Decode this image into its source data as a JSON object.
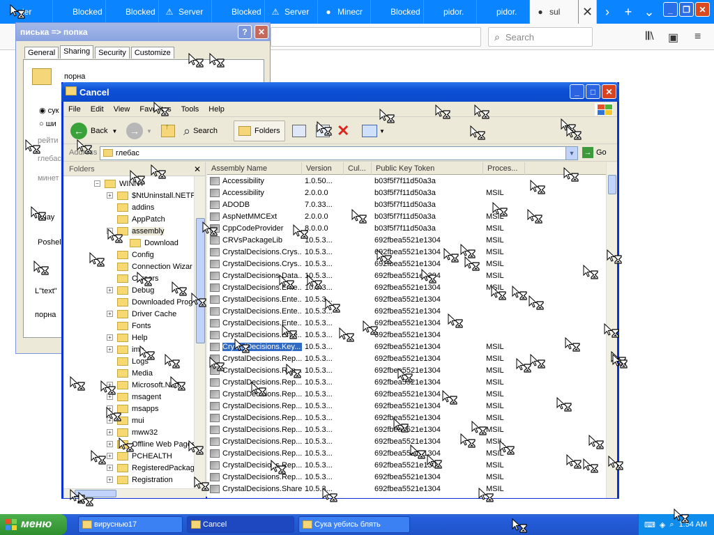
{
  "browser": {
    "tabs": [
      {
        "label": "der",
        "icon": "",
        "active": false
      },
      {
        "label": "Blocked",
        "icon": "",
        "active": false
      },
      {
        "label": "Blocked",
        "icon": "",
        "active": false
      },
      {
        "label": "Server",
        "icon": "⚠",
        "active": false
      },
      {
        "label": "Blocked",
        "icon": "",
        "active": false
      },
      {
        "label": "Server",
        "icon": "⚠",
        "active": false
      },
      {
        "label": "Minecr",
        "icon": "●",
        "active": false
      },
      {
        "label": "Blocked",
        "icon": "",
        "active": false
      },
      {
        "label": "pidor.",
        "icon": "",
        "active": false
      },
      {
        "label": "pidor.",
        "icon": "",
        "active": false
      },
      {
        "label": "sul",
        "icon": "●",
        "active": true
      }
    ],
    "close_tab": "✕",
    "scroll_right": "›",
    "new_tab": "+",
    "tab_list": "⌄",
    "search_placeholder": "Search",
    "win_min": "_",
    "win_max": "❐",
    "win_close": "✕"
  },
  "props_dialog": {
    "title": "писька => попка",
    "help": "?",
    "close": "✕",
    "tabs": [
      "General",
      "Sharing",
      "Security",
      "Customize"
    ],
    "selected_tab": "Sharing",
    "folder_name": "порна",
    "opt1": "сук",
    "opt2": "ши",
    "gray1": "рейти",
    "gray2": "глебас",
    "gray3": "минет",
    "text1": "Вчау",
    "text2": "Poshel",
    "text3": "L\"text\"",
    "text4": "порна"
  },
  "explorer": {
    "title": "Cancel",
    "menu": [
      "File",
      "Edit",
      "View",
      "Favorites",
      "Tools",
      "Help"
    ],
    "back_label": "Back",
    "search_label": "Search",
    "folders_label": "Folders",
    "address_label": "Address",
    "address_value": "глебас",
    "go_label": "Go",
    "folders_pane_title": "Folders",
    "tree": [
      {
        "label": "WINNT",
        "indent": 0,
        "exp": "−"
      },
      {
        "label": "$NtUninstall.NETF",
        "indent": 1,
        "exp": "+"
      },
      {
        "label": "addins",
        "indent": 1,
        "exp": ""
      },
      {
        "label": "AppPatch",
        "indent": 1,
        "exp": ""
      },
      {
        "label": "assembly",
        "indent": 1,
        "exp": "−",
        "selected": true
      },
      {
        "label": "Download",
        "indent": 2,
        "exp": ""
      },
      {
        "label": "Config",
        "indent": 1,
        "exp": ""
      },
      {
        "label": "Connection Wizar",
        "indent": 1,
        "exp": ""
      },
      {
        "label": "Cursors",
        "indent": 1,
        "exp": ""
      },
      {
        "label": "Debug",
        "indent": 1,
        "exp": "+"
      },
      {
        "label": "Downloaded Prog",
        "indent": 1,
        "exp": ""
      },
      {
        "label": "Driver Cache",
        "indent": 1,
        "exp": "+"
      },
      {
        "label": "Fonts",
        "indent": 1,
        "exp": ""
      },
      {
        "label": "Help",
        "indent": 1,
        "exp": "+"
      },
      {
        "label": "ime",
        "indent": 1,
        "exp": "+"
      },
      {
        "label": "Logs",
        "indent": 1,
        "exp": ""
      },
      {
        "label": "Media",
        "indent": 1,
        "exp": ""
      },
      {
        "label": "Microsoft.NET",
        "indent": 1,
        "exp": "+"
      },
      {
        "label": "msagent",
        "indent": 1,
        "exp": "+"
      },
      {
        "label": "msapps",
        "indent": 1,
        "exp": "+"
      },
      {
        "label": "mui",
        "indent": 1,
        "exp": "+"
      },
      {
        "label": "mww32",
        "indent": 1,
        "exp": "+"
      },
      {
        "label": "Offline Web Pages",
        "indent": 1,
        "exp": "+"
      },
      {
        "label": "PCHEALTH",
        "indent": 1,
        "exp": "+"
      },
      {
        "label": "RegisteredPackag",
        "indent": 1,
        "exp": "+"
      },
      {
        "label": "Registration",
        "indent": 1,
        "exp": "+"
      }
    ],
    "columns": [
      "Assembly Name",
      "Version",
      "Cul...",
      "Public Key Token",
      "Proces..."
    ],
    "rows": [
      {
        "name": "Accessibility",
        "version": "1.0.50...",
        "culture": "",
        "token": "b03f5f7f11d50a3a",
        "proc": ""
      },
      {
        "name": "Accessibility",
        "version": "2.0.0.0",
        "culture": "",
        "token": "b03f5f7f11d50a3a",
        "proc": "MSIL"
      },
      {
        "name": "ADODB",
        "version": "7.0.33...",
        "culture": "",
        "token": "b03f5f7f11d50a3a",
        "proc": ""
      },
      {
        "name": "AspNetMMCExt",
        "version": "2.0.0.0",
        "culture": "",
        "token": "b03f5f7f11d50a3a",
        "proc": "MSIL"
      },
      {
        "name": "CppCodeProvider",
        "version": "8.0.0.0",
        "culture": "",
        "token": "b03f5f7f11d50a3a",
        "proc": "MSIL"
      },
      {
        "name": "CRVsPackageLib",
        "version": "10.5.3...",
        "culture": "",
        "token": "692fbea5521e1304",
        "proc": "MSIL"
      },
      {
        "name": "CrystalDecisions.Crys...",
        "version": "10.5.3...",
        "culture": "",
        "token": "692fbea5521e1304",
        "proc": "MSIL"
      },
      {
        "name": "CrystalDecisions.Crys...",
        "version": "10.5.3...",
        "culture": "",
        "token": "692fbea5521e1304",
        "proc": "MSIL"
      },
      {
        "name": "CrystalDecisions.Data...",
        "version": "10.5.3...",
        "culture": "",
        "token": "692fbea5521e1304",
        "proc": "MSIL"
      },
      {
        "name": "CrystalDecisions.Ente...",
        "version": "10.5.3...",
        "culture": "",
        "token": "692fbea5521e1304",
        "proc": "MSIL"
      },
      {
        "name": "CrystalDecisions.Ente...",
        "version": "10.5.3...",
        "culture": "",
        "token": "692fbea5521e1304",
        "proc": ""
      },
      {
        "name": "CrystalDecisions.Ente...",
        "version": "10.5.3...",
        "culture": "",
        "token": "692fbea5521e1304",
        "proc": ""
      },
      {
        "name": "CrystalDecisions.Ente...",
        "version": "10.5.3...",
        "culture": "",
        "token": "692fbea5521e1304",
        "proc": ""
      },
      {
        "name": "CrystalDecisions.Ente...",
        "version": "10.5.3...",
        "culture": "",
        "token": "692fbea5521e1304",
        "proc": ""
      },
      {
        "name": "CrystalDecisions.Key...",
        "version": "10.5.3...",
        "culture": "",
        "token": "692fbea5521e1304",
        "proc": "MSIL",
        "selected": true
      },
      {
        "name": "CrystalDecisions.Rep...",
        "version": "10.5.3...",
        "culture": "",
        "token": "692fbea5521e1304",
        "proc": "MSIL"
      },
      {
        "name": "CrystalDecisions.Rep...",
        "version": "10.5.3...",
        "culture": "",
        "token": "692fbea5521e1304",
        "proc": "MSIL"
      },
      {
        "name": "CrystalDecisions.Rep...",
        "version": "10.5.3...",
        "culture": "",
        "token": "692fbea5521e1304",
        "proc": "MSIL"
      },
      {
        "name": "CrystalDecisions.Rep...",
        "version": "10.5.3...",
        "culture": "",
        "token": "692fbea5521e1304",
        "proc": "MSIL"
      },
      {
        "name": "CrystalDecisions.Rep...",
        "version": "10.5.3...",
        "culture": "",
        "token": "692fbea5521e1304",
        "proc": "MSIL"
      },
      {
        "name": "CrystalDecisions.Rep...",
        "version": "10.5.3...",
        "culture": "",
        "token": "692fbea5521e1304",
        "proc": "MSIL"
      },
      {
        "name": "CrystalDecisions.Rep...",
        "version": "10.5.3...",
        "culture": "",
        "token": "692fbea5521e1304",
        "proc": "MSIL"
      },
      {
        "name": "CrystalDecisions.Rep...",
        "version": "10.5.3...",
        "culture": "",
        "token": "692fbea5521e1304",
        "proc": "MSIL"
      },
      {
        "name": "CrystalDecisions.Rep...",
        "version": "10.5.3...",
        "culture": "",
        "token": "692fbea5521e1304",
        "proc": "MSIL"
      },
      {
        "name": "CrystalDecisions.Rep...",
        "version": "10.5.3...",
        "culture": "",
        "token": "692fbea5521e1304",
        "proc": "MSIL"
      },
      {
        "name": "CrystalDecisions.Rep...",
        "version": "10.5.3...",
        "culture": "",
        "token": "692fbea5521e1304",
        "proc": "MSIL"
      },
      {
        "name": "CrystalDecisions.Shared",
        "version": "10.5.3...",
        "culture": "",
        "token": "692fbea5521e1304",
        "proc": "MSIL"
      }
    ]
  },
  "taskbar": {
    "start_label": "меню",
    "tasks": [
      {
        "label": "вируснью17",
        "active": false
      },
      {
        "label": "Cancel",
        "active": true
      },
      {
        "label": "Сука уебись блять",
        "active": false
      }
    ],
    "clock": "1:54 AM"
  },
  "colors": {
    "xp_blue": "#0831d9",
    "firefox_blue": "#0a84ff",
    "selection": "#316ac5",
    "start_green": "#3c9a3c"
  }
}
